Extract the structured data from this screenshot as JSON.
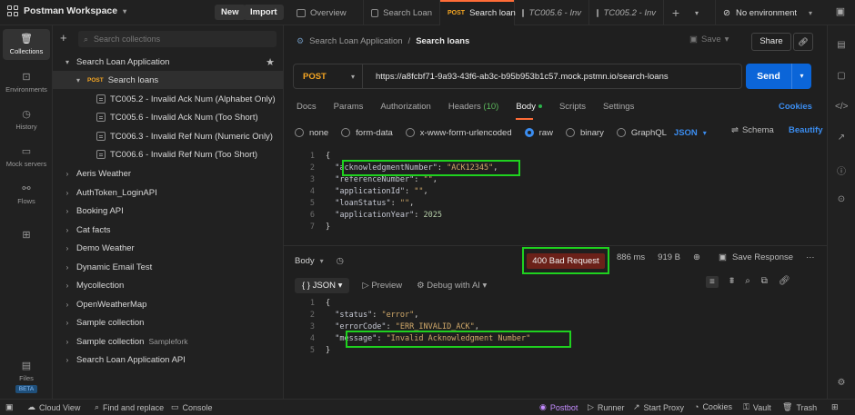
{
  "topbar": {
    "workspace": "Postman Workspace",
    "new_label": "New",
    "import_label": "Import",
    "tabs": [
      {
        "label": "Overview",
        "method": ""
      },
      {
        "label": "Search Loan",
        "method": ""
      },
      {
        "label": "Search loan",
        "method": "POST"
      },
      {
        "label": "TC005.6 - Inv",
        "method": ""
      },
      {
        "label": "TC005.2 - Inv",
        "method": ""
      }
    ],
    "environment": "No environment"
  },
  "rail": {
    "items": [
      "Collections",
      "Environments",
      "History",
      "Mock servers",
      "Flows"
    ],
    "files_label": "Files",
    "beta_label": "BETA"
  },
  "sidebar": {
    "search_placeholder": "Search collections",
    "tree": [
      {
        "label": "Search Loan Application",
        "chevron": "▾",
        "indent": 0
      },
      {
        "label": "Search loans",
        "chevron": "▾",
        "indent": 1,
        "method": "POST"
      },
      {
        "label": "TC005.2 - Invalid Ack Num (Alphabet Only)",
        "indent": 2
      },
      {
        "label": "TC005.6 - Invalid Ack Num (Too Short)",
        "indent": 2
      },
      {
        "label": "TC006.3 - Invalid Ref Num (Numeric Only)",
        "indent": 2
      },
      {
        "label": "TC006.6 - Invalid Ref Num (Too Short)",
        "indent": 2
      },
      {
        "label": "Aeris Weather",
        "chevron": "›",
        "indent": 0
      },
      {
        "label": "AuthToken_LoginAPI",
        "chevron": "›",
        "indent": 0
      },
      {
        "label": "Booking API",
        "chevron": "›",
        "indent": 0
      },
      {
        "label": "Cat facts",
        "chevron": "›",
        "indent": 0
      },
      {
        "label": "Demo Weather",
        "chevron": "›",
        "indent": 0
      },
      {
        "label": "Dynamic Email Test",
        "chevron": "›",
        "indent": 0
      },
      {
        "label": "Mycollection",
        "chevron": "›",
        "indent": 0
      },
      {
        "label": "OpenWeatherMap",
        "chevron": "›",
        "indent": 0
      },
      {
        "label": "Sample collection",
        "chevron": "›",
        "indent": 0
      },
      {
        "label": "Sample collection",
        "chevron": "›",
        "indent": 0,
        "fork": "Samplefork"
      },
      {
        "label": "Search Loan Application API",
        "chevron": "›",
        "indent": 0
      }
    ]
  },
  "request": {
    "breadcrumb_parent": "Search Loan Application",
    "breadcrumb_sep": "/",
    "breadcrumb_current": "Search loans",
    "save_label": "Save",
    "share_label": "Share",
    "method": "POST",
    "url": "https://a8fcbf71-9a93-43f6-ab3c-b95b953b1c57.mock.pstmn.io/search-loans",
    "send_label": "Send",
    "tabs": [
      "Docs",
      "Params",
      "Authorization",
      "Headers",
      "Body",
      "Scripts",
      "Settings"
    ],
    "headers_count": "(10)",
    "cookies_label": "Cookies",
    "body_options": [
      "none",
      "form-data",
      "x-www-form-urlencoded",
      "raw",
      "binary",
      "GraphQL"
    ],
    "body_format": "JSON",
    "schema_label": "Schema",
    "beautify_label": "Beautify",
    "body_lines": [
      {
        "num": "1",
        "key": "",
        "value": "",
        "text": "{"
      },
      {
        "num": "2",
        "key": "\"acknowledgmentNumber\"",
        "value": "\"ACK12345\"",
        "tail": ","
      },
      {
        "num": "3",
        "key": "\"referenceNumber\"",
        "value": "\"\"",
        "tail": ","
      },
      {
        "num": "4",
        "key": "\"applicationId\"",
        "value": "\"\"",
        "tail": ","
      },
      {
        "num": "5",
        "key": "\"loanStatus\"",
        "value": "\"\"",
        "tail": ","
      },
      {
        "num": "6",
        "key": "\"applicationYear\"",
        "value": "2025",
        "tail": ""
      },
      {
        "num": "7",
        "key": "",
        "value": "",
        "text": "}"
      }
    ]
  },
  "response": {
    "body_label": "Body",
    "status": "400 Bad Request",
    "time": "886 ms",
    "size": "919 B",
    "save_response_label": "Save Response",
    "format": "JSON",
    "preview_label": "Preview",
    "debug_label": "Debug with AI",
    "lines": [
      {
        "num": "1",
        "text": "{"
      },
      {
        "num": "2",
        "key": "\"status\"",
        "value": "\"error\"",
        "tail": ","
      },
      {
        "num": "3",
        "key": "\"errorCode\"",
        "value": "\"ERR_INVALID_ACK\"",
        "tail": ","
      },
      {
        "num": "4",
        "key": "\"message\"",
        "value": "\"Invalid Acknowledgment Number\"",
        "tail": ""
      },
      {
        "num": "5",
        "text": "}"
      }
    ]
  },
  "statusbar": {
    "cloud_view": "Cloud View",
    "find_replace": "Find and replace",
    "console": "Console",
    "postbot": "Postbot",
    "runner": "Runner",
    "start_proxy": "Start Proxy",
    "cookies": "Cookies",
    "vault": "Vault",
    "trash": "Trash"
  },
  "colors": {
    "accent": "#ff6c37",
    "send": "#0b65d8",
    "post": "#f5a623",
    "highlight": "#1fd11f",
    "error_badge": "#6b2119"
  }
}
